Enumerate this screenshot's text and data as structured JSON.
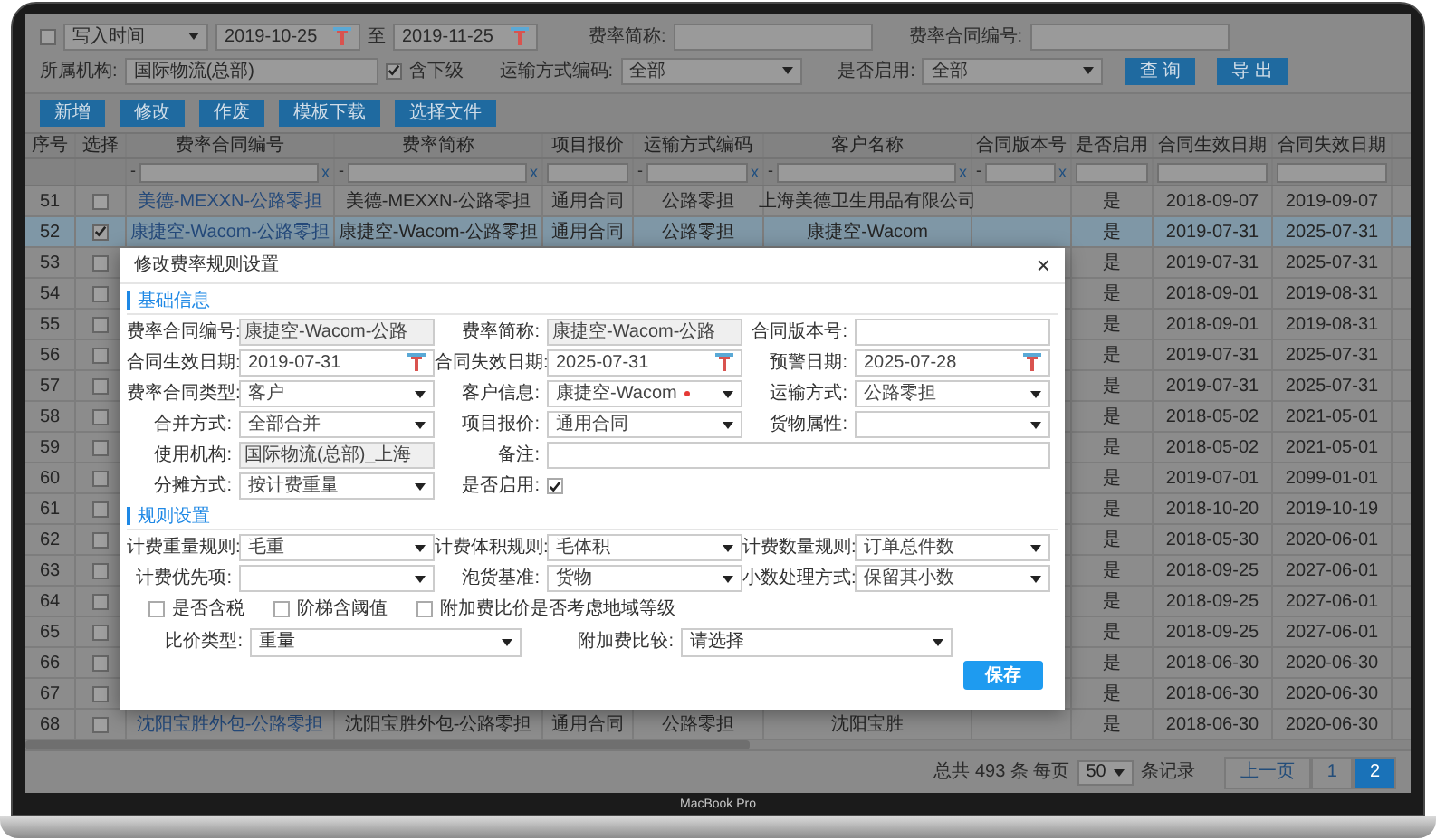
{
  "filters": {
    "date_check": {
      "checked": false
    },
    "date_type": "写入时间",
    "date_from": "2019-10-25",
    "to_label": "至",
    "date_to": "2019-11-25",
    "short_name": {
      "label": "费率简称:"
    },
    "contract_no": {
      "label": "费率合同编号:"
    },
    "org": {
      "label": "所属机构:",
      "value": "国际物流(总部)"
    },
    "include_sub": {
      "label": "含下级",
      "checked": true
    },
    "transport": {
      "label": "运输方式编码:",
      "value": "全部"
    },
    "enabled": {
      "label": "是否启用:",
      "value": "全部"
    },
    "buttons": [
      "查 询",
      "导 出"
    ]
  },
  "toolbar": [
    "新增",
    "修改",
    "作废",
    "模板下载",
    "选择文件"
  ],
  "table": {
    "columns": [
      {
        "label": "序号",
        "filter": false
      },
      {
        "label": "选择",
        "filter": false
      },
      {
        "label": "费率合同编号",
        "filter": true,
        "prefix": "-",
        "clear": "x"
      },
      {
        "label": "费率简称",
        "filter": true,
        "prefix": "-",
        "clear": "x"
      },
      {
        "label": "项目报价",
        "filter": true
      },
      {
        "label": "运输方式编码",
        "filter": true,
        "prefix": "-",
        "clear": "x"
      },
      {
        "label": "客户名称",
        "filter": true,
        "prefix": "-",
        "clear": "x"
      },
      {
        "label": "合同版本号",
        "filter": true,
        "prefix": "-",
        "clear": "x"
      },
      {
        "label": "是否启用",
        "filter": true
      },
      {
        "label": "合同生效日期",
        "filter": true
      },
      {
        "label": "合同失效日期",
        "filter": true
      }
    ],
    "rows": [
      {
        "no": "51",
        "selected": false,
        "code": "美德-MEXXN-公路零担",
        "name": "美德-MEXXN-公路零担",
        "quote": "通用合同",
        "transport": "公路零担",
        "customer": "上海美德卫生用品有限公司",
        "enabled": "是",
        "start": "2018-09-07",
        "end": "2019-09-07"
      },
      {
        "no": "52",
        "selected": true,
        "code": "康捷空-Wacom-公路零担",
        "name": "康捷空-Wacom-公路零担",
        "quote": "通用合同",
        "transport": "公路零担",
        "customer": "康捷空-Wacom",
        "enabled": "是",
        "start": "2019-07-31",
        "end": "2025-07-31"
      },
      {
        "no": "53",
        "selected": false,
        "enabled": "是",
        "start": "2019-07-31",
        "end": "2025-07-31"
      },
      {
        "no": "54",
        "selected": false,
        "enabled": "是",
        "start": "2018-09-01",
        "end": "2019-08-31"
      },
      {
        "no": "55",
        "selected": false,
        "enabled": "是",
        "start": "2018-09-01",
        "end": "2019-08-31"
      },
      {
        "no": "56",
        "selected": false,
        "enabled": "是",
        "start": "2019-07-31",
        "end": "2025-07-31"
      },
      {
        "no": "57",
        "selected": false,
        "enabled": "是",
        "start": "2019-07-31",
        "end": "2025-07-31"
      },
      {
        "no": "58",
        "selected": false,
        "enabled": "是",
        "start": "2018-05-02",
        "end": "2021-05-01"
      },
      {
        "no": "59",
        "selected": false,
        "enabled": "是",
        "start": "2018-05-02",
        "end": "2021-05-01"
      },
      {
        "no": "60",
        "selected": false,
        "enabled": "是",
        "start": "2019-07-01",
        "end": "2099-01-01"
      },
      {
        "no": "61",
        "selected": false,
        "enabled": "是",
        "start": "2018-10-20",
        "end": "2019-10-19"
      },
      {
        "no": "62",
        "selected": false,
        "enabled": "是",
        "start": "2018-05-30",
        "end": "2020-06-01"
      },
      {
        "no": "63",
        "selected": false,
        "enabled": "是",
        "start": "2018-09-25",
        "end": "2027-06-01"
      },
      {
        "no": "64",
        "selected": false,
        "enabled": "是",
        "start": "2018-09-25",
        "end": "2027-06-01"
      },
      {
        "no": "65",
        "selected": false,
        "enabled": "是",
        "start": "2018-09-25",
        "end": "2027-06-01"
      },
      {
        "no": "66",
        "selected": false,
        "enabled": "是",
        "start": "2018-06-30",
        "end": "2020-06-30"
      },
      {
        "no": "67",
        "selected": false,
        "enabled": "是",
        "start": "2018-06-30",
        "end": "2020-06-30"
      },
      {
        "no": "68",
        "selected": false,
        "code": "沈阳宝胜外包-公路零担",
        "name": "沈阳宝胜外包-公路零担",
        "quote": "通用合同",
        "transport": "公路零担",
        "customer": "沈阳宝胜",
        "enabled": "是",
        "start": "2018-06-30",
        "end": "2020-06-30"
      }
    ]
  },
  "pagination": {
    "summary": "总共 493 条 每页",
    "page_size": "50",
    "suffix": "条记录",
    "pages": [
      {
        "label": "上一页",
        "selected": false
      },
      {
        "label": "1",
        "selected": false
      },
      {
        "label": "2",
        "selected": true
      }
    ]
  },
  "dialog": {
    "title": "修改费率规则设置",
    "close": "×",
    "basic_section": "基础信息",
    "basic_rows": [
      [
        {
          "label": "费率合同编号:",
          "kind": "text",
          "value": "康捷空-Wacom-公路",
          "disabled": true
        },
        {
          "label": "费率简称:",
          "kind": "text",
          "value": "康捷空-Wacom-公路",
          "disabled": true
        },
        {
          "label": "合同版本号:",
          "kind": "text",
          "disabled": false
        }
      ],
      [
        {
          "label": "合同生效日期:",
          "kind": "date",
          "value": "2019-07-31"
        },
        {
          "label": "合同失效日期:",
          "kind": "date",
          "value": "2025-07-31"
        },
        {
          "label": "预警日期:",
          "kind": "date",
          "value": "2025-07-28"
        }
      ],
      [
        {
          "label": "费率合同类型:",
          "kind": "select",
          "value": "客户"
        },
        {
          "label": "客户信息:",
          "kind": "select",
          "value": "康捷空-Wacom",
          "required": true
        },
        {
          "label": "运输方式:",
          "kind": "select",
          "value": "公路零担"
        }
      ],
      [
        {
          "label": "合并方式:",
          "kind": "select",
          "value": "全部合并"
        },
        {
          "label": "项目报价:",
          "kind": "select",
          "value": "通用合同"
        },
        {
          "label": "货物属性:",
          "kind": "select"
        }
      ],
      [
        {
          "label": "使用机构:",
          "kind": "text",
          "value": "国际物流(总部)_上海",
          "disabled": true
        },
        {
          "label": "备注:",
          "kind": "wide"
        }
      ],
      [
        {
          "label": "分摊方式:",
          "kind": "select",
          "value": "按计费重量"
        },
        {
          "label": "是否启用:",
          "kind": "checkbox",
          "checked": true
        }
      ]
    ],
    "rule_section": "规则设置",
    "rule_rows": [
      [
        {
          "label": "计费重量规则:",
          "kind": "select",
          "value": "毛重"
        },
        {
          "label": "计费体积规则:",
          "kind": "select",
          "value": "毛体积"
        },
        {
          "label": "计费数量规则:",
          "kind": "select",
          "value": "订单总件数"
        }
      ],
      [
        {
          "label": "计费优先项:",
          "kind": "select"
        },
        {
          "label": "泡货基准:",
          "kind": "select",
          "value": "货物"
        },
        {
          "label": "小数处理方式:",
          "kind": "select",
          "value": "保留其小数"
        }
      ]
    ],
    "options": [
      {
        "label": "是否含税",
        "checked": false
      },
      {
        "label": "阶梯含阈值",
        "checked": false
      },
      {
        "label": "附加费比价是否考虑地域等级",
        "checked": false
      }
    ],
    "compare": [
      {
        "label": "比价类型:",
        "value": "重量"
      },
      {
        "label": "附加费比较:",
        "value": "请选择"
      }
    ],
    "save": "保存"
  },
  "device_label": "MacBook Pro"
}
